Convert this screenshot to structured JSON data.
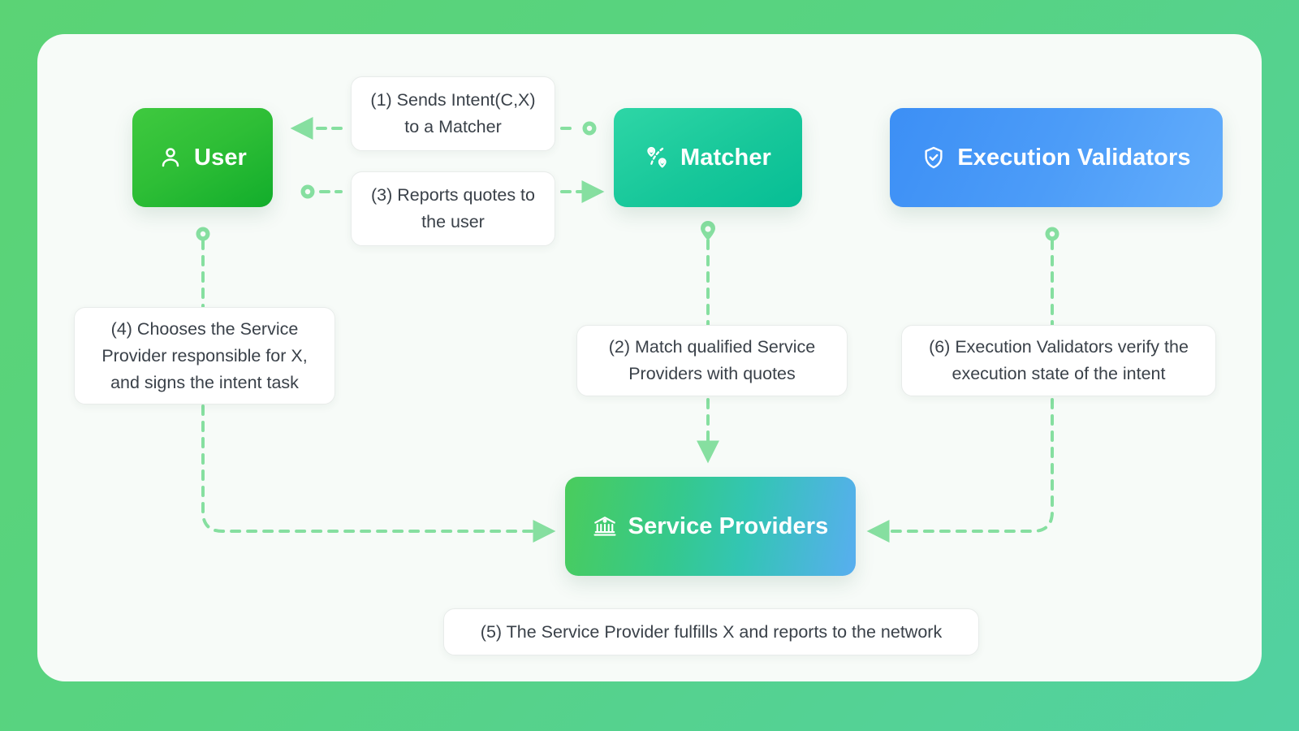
{
  "theme": {
    "page_background_start": "#5BD375",
    "page_background_end": "#52D1A2",
    "card_background": "#F7FBF8",
    "connector_color": "#86DFA0",
    "chip_text_color": "#3A4149",
    "chip_background": "#FFFFFF",
    "chip_border": "#E8ECEA"
  },
  "nodes": {
    "user": {
      "label": "User",
      "icon": "person-icon",
      "color_start": "#3FC93F",
      "color_end": "#12AD2B"
    },
    "matcher": {
      "label": "Matcher",
      "icon": "route-pins-icon",
      "color_start": "#2ED6A6",
      "color_end": "#06BE95"
    },
    "validators": {
      "label": "Execution Validators",
      "icon": "shield-check-icon",
      "color_start": "#3C8FF5",
      "color_end": "#64AEFB"
    },
    "providers": {
      "label": "Service Providers",
      "icon": "bank-icon",
      "color_start": "#4ACC5C",
      "color_end": "#58AEF0"
    }
  },
  "steps": {
    "step1": "(1) Sends Intent(C,X) to a Matcher",
    "step2": "(2) Match qualified Service Providers with quotes",
    "step3": "(3) Reports quotes to the user",
    "step4": "(4) Chooses the Service Provider responsible for X, and signs the intent task",
    "step5": "(5) The Service Provider fulfills X and reports to the network",
    "step6": "(6) Execution Validators verify the execution state of the intent"
  },
  "flow": {
    "edges": [
      {
        "id": "edge-1",
        "from": "matcher",
        "to": "user",
        "label_ref": "step1",
        "direction": "right-to-left",
        "style": "dashed"
      },
      {
        "id": "edge-3",
        "from": "user",
        "to": "matcher",
        "label_ref": "step3",
        "direction": "left-to-right",
        "style": "dashed"
      },
      {
        "id": "edge-2",
        "from": "matcher",
        "to": "providers",
        "label_ref": "step2",
        "direction": "top-to-bottom",
        "style": "dashed"
      },
      {
        "id": "edge-4",
        "from": "user",
        "to": "providers",
        "label_ref": "step4",
        "direction": "down-then-right",
        "style": "dashed"
      },
      {
        "id": "edge-6",
        "from": "validators",
        "to": "providers",
        "label_ref": "step6",
        "direction": "down-then-left",
        "style": "dashed"
      },
      {
        "id": "edge-5",
        "from": "providers",
        "to": "network",
        "label_ref": "step5",
        "direction": "caption",
        "style": "none"
      }
    ]
  }
}
